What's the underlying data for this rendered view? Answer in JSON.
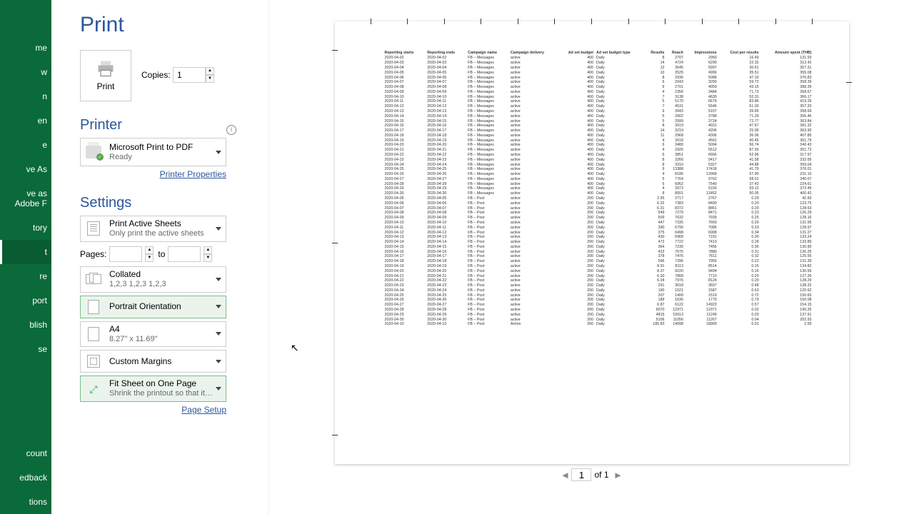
{
  "nav": {
    "items": [
      "me",
      "w",
      "n",
      "en",
      "e",
      "ve As",
      "ve as Adobe\nF",
      "tory",
      "t",
      "re",
      "port",
      "blish",
      "se"
    ],
    "bottom": [
      "count",
      "edback",
      "tions"
    ],
    "active_index": 8
  },
  "title": "Print",
  "print_button": "Print",
  "copies": {
    "label": "Copies:",
    "value": "1"
  },
  "printer": {
    "heading": "Printer",
    "name": "Microsoft Print to PDF",
    "status": "Ready",
    "properties_link": "Printer Properties"
  },
  "settings": {
    "heading": "Settings",
    "active_sheets": {
      "title": "Print Active Sheets",
      "sub": "Only print the active sheets"
    },
    "pages_label": "Pages:",
    "to_label": "to",
    "collated": {
      "title": "Collated",
      "sub": "1,2,3    1,2,3    1,2,3"
    },
    "orientation": "Portrait Orientation",
    "paper": {
      "title": "A4",
      "sub": "8.27\" x 11.69\""
    },
    "margins": "Custom Margins",
    "fit": {
      "title": "Fit Sheet on One Page",
      "sub": "Shrink the printout so that it…"
    },
    "page_setup_link": "Page Setup"
  },
  "pager": {
    "current": "1",
    "of": "of 1"
  },
  "preview": {
    "headers": [
      "Reporting starts",
      "Reporting ends",
      "Campaign name",
      "Campaign delivery",
      "Ad set budget",
      "Ad set budget type",
      "Results",
      "Reach",
      "Impressions",
      "Cost per results",
      "Amount spent (THB)"
    ],
    "rows": [
      [
        "2020-04-02",
        "2020-04-02",
        "FB – Messages",
        "active",
        "400",
        "Daily",
        "8",
        "2707",
        "2950",
        "16.49",
        "131.93"
      ],
      [
        "2020-04-03",
        "2020-04-03",
        "FB – Messages",
        "active",
        "400",
        "Daily",
        "14",
        "4724",
        "6290",
        "22.32",
        "312.42"
      ],
      [
        "2020-04-04",
        "2020-04-04",
        "FB – Messages",
        "active",
        "400",
        "Daily",
        "12",
        "3645",
        "5997",
        "30.61",
        "367.31"
      ],
      [
        "2020-04-05",
        "2020-04-05",
        "FB – Messages",
        "active",
        "400",
        "Daily",
        "10",
        "3525",
        "4996",
        "35.51",
        "355.08"
      ],
      [
        "2020-04-06",
        "2020-04-06",
        "FB – Messages",
        "active",
        "400",
        "Daily",
        "8",
        "2936",
        "5088",
        "47.10",
        "376.83"
      ],
      [
        "2020-04-07",
        "2020-04-07",
        "FB – Messages",
        "active",
        "400",
        "Daily",
        "6",
        "2043",
        "3200",
        "59.73",
        "358.39"
      ],
      [
        "2020-04-08",
        "2020-04-08",
        "FB – Messages",
        "active",
        "400",
        "Daily",
        "9",
        "2701",
        "4059",
        "43.15",
        "388.39"
      ],
      [
        "2020-04-09",
        "2020-04-09",
        "FB – Messages",
        "active",
        "400",
        "Daily",
        "4",
        "2356",
        "3484",
        "71.73",
        "358.67"
      ],
      [
        "2020-04-10",
        "2020-04-10",
        "FB – Messages",
        "active",
        "400",
        "Daily",
        "7",
        "3138",
        "4630",
        "52.31",
        "366.17"
      ],
      [
        "2020-04-11",
        "2020-04-11",
        "FB – Messages",
        "active",
        "400",
        "Daily",
        "5",
        "5170",
        "6679",
        "83.86",
        "419.29"
      ],
      [
        "2020-04-12",
        "2020-04-12",
        "FB – Messages",
        "active",
        "400",
        "Daily",
        "7",
        "4531",
        "5646",
        "51.03",
        "357.20"
      ],
      [
        "2020-04-13",
        "2020-04-13",
        "FB – Messages",
        "active",
        "400",
        "Daily",
        "9",
        "3943",
        "5157",
        "39.85",
        "358.69"
      ],
      [
        "2020-04-14",
        "2020-04-14",
        "FB – Messages",
        "active",
        "400",
        "Daily",
        "5",
        "2802",
        "3788",
        "71.29",
        "356.46"
      ],
      [
        "2020-04-15",
        "2020-04-15",
        "FB – Messages",
        "active",
        "400",
        "Daily",
        "5",
        "2999",
        "3724",
        "72.77",
        "363.84"
      ],
      [
        "2020-04-16",
        "2020-04-16",
        "FB – Messages",
        "active",
        "400",
        "Daily",
        "8",
        "3019",
        "4031",
        "47.67",
        "381.32"
      ],
      [
        "2020-04-17",
        "2020-04-17",
        "FB – Messages",
        "active",
        "400",
        "Daily",
        "14",
        "3219",
        "4206",
        "25.99",
        "363.90"
      ],
      [
        "2020-04-18",
        "2020-04-18",
        "FB – Messages",
        "active",
        "400",
        "Daily",
        "11",
        "2968",
        "4306",
        "36.06",
        "407.85"
      ],
      [
        "2020-04-19",
        "2020-04-19",
        "FB – Messages",
        "active",
        "400",
        "Daily",
        "4",
        "2618",
        "4562",
        "90.45",
        "361.79"
      ],
      [
        "2020-04-20",
        "2020-04-20",
        "FB – Messages",
        "active",
        "400",
        "Daily",
        "6",
        "3480",
        "5094",
        "56.74",
        "340.43"
      ],
      [
        "2020-04-21",
        "2020-04-21",
        "FB – Messages",
        "active",
        "400",
        "Daily",
        "4",
        "2926",
        "5512",
        "87.93",
        "351.72"
      ],
      [
        "2020-04-22",
        "2020-04-22",
        "FB – Messages",
        "active",
        "400",
        "Daily",
        "6",
        "3851",
        "6666",
        "52.96",
        "317.97"
      ],
      [
        "2020-04-23",
        "2020-04-23",
        "FB – Messages",
        "active",
        "400",
        "Daily",
        "8",
        "3266",
        "5417",
        "41.58",
        "332.65"
      ],
      [
        "2020-04-24",
        "2020-04-24",
        "FB – Messages",
        "active",
        "400",
        "Daily",
        "8",
        "3310",
        "5327",
        "44.88",
        "359.04"
      ],
      [
        "2020-04-25",
        "2020-04-25",
        "FB – Messages",
        "active",
        "400",
        "Daily",
        "9",
        "13388",
        "17418",
        "41.79",
        "376.01"
      ],
      [
        "2020-04-26",
        "2020-04-26",
        "FB – Messages",
        "active",
        "400",
        "Daily",
        "4",
        "8186",
        "12968",
        "57.90",
        "231.10"
      ],
      [
        "2020-04-27",
        "2020-04-27",
        "FB – Messages",
        "active",
        "400",
        "Daily",
        "5",
        "7764",
        "9762",
        "68.01",
        "340.07"
      ],
      [
        "2020-04-28",
        "2020-04-28",
        "FB – Messages",
        "active",
        "400",
        "Daily",
        "6",
        "6062",
        "7540",
        "37.43",
        "224.61"
      ],
      [
        "2020-04-29",
        "2020-04-29",
        "FB – Messages",
        "active",
        "400",
        "Daily",
        "4",
        "3973",
        "5150",
        "93.12",
        "372.49"
      ],
      [
        "2020-04-30",
        "2020-04-30",
        "FB – Messages",
        "active",
        "400",
        "Daily",
        "8",
        "8001",
        "12452",
        "50.05",
        "400.42"
      ],
      [
        "2020-04-05",
        "2020-04-05",
        "FB – Post",
        "active",
        "200",
        "Daily",
        "2.55",
        "2717",
        "2767",
        "0.29",
        "42.50"
      ],
      [
        "2020-04-06",
        "2020-04-06",
        "FB – Post",
        "active",
        "200",
        "Daily",
        "6.32",
        "7383",
        "8490",
        "0.20",
        "123.75"
      ],
      [
        "2020-04-07",
        "2020-04-07",
        "FB – Post",
        "active",
        "200",
        "Daily",
        "6.31",
        "8372",
        "8861",
        "0.20",
        "128.63"
      ],
      [
        "2020-04-08",
        "2020-04-08",
        "FB – Post",
        "active",
        "200",
        "Daily",
        "549",
        "7279",
        "8471",
        "0.23",
        "126.29"
      ],
      [
        "2020-04-09",
        "2020-04-09",
        "FB – Post",
        "active",
        "200",
        "Daily",
        "509",
        "7632",
        "7939",
        "0.25",
        "128.16"
      ],
      [
        "2020-04-10",
        "2020-04-10",
        "FB – Post",
        "active",
        "200",
        "Daily",
        "447",
        "7335",
        "7669",
        "0.29",
        "131.95"
      ],
      [
        "2020-04-11",
        "2020-04-11",
        "FB – Post",
        "active",
        "200",
        "Daily",
        "390",
        "6790",
        "7086",
        "0.33",
        "128.97"
      ],
      [
        "2020-04-12",
        "2020-04-12",
        "FB – Post",
        "active",
        "200",
        "Daily",
        "375",
        "6498",
        "6908",
        "0.34",
        "131.27"
      ],
      [
        "2020-04-13",
        "2020-04-13",
        "FB – Post",
        "active",
        "200",
        "Daily",
        "430",
        "6968",
        "7191",
        "0.30",
        "133.24"
      ],
      [
        "2020-04-14",
        "2020-04-14",
        "FB – Post",
        "active",
        "200",
        "Daily",
        "472",
        "7722",
        "7413",
        "0.28",
        "133.89"
      ],
      [
        "2020-04-15",
        "2020-04-15",
        "FB – Post",
        "active",
        "200",
        "Daily",
        "364",
        "7230",
        "7456",
        "0.36",
        "130.90"
      ],
      [
        "2020-04-16",
        "2020-04-16",
        "FB – Post",
        "active",
        "200",
        "Daily",
        "423",
        "7676",
        "7880",
        "0.31",
        "130.25"
      ],
      [
        "2020-04-17",
        "2020-04-17",
        "FB – Post",
        "active",
        "200",
        "Daily",
        "378",
        "7476",
        "7611",
        "0.32",
        "125.55"
      ],
      [
        "2020-04-18",
        "2020-04-18",
        "FB – Post",
        "active",
        "200",
        "Daily",
        "596",
        "7396",
        "7955",
        "0.22",
        "131.39"
      ],
      [
        "2020-04-19",
        "2020-04-19",
        "FB – Post",
        "active",
        "200",
        "Daily",
        "8.91",
        "8113",
        "8514",
        "0.15",
        "134.82"
      ],
      [
        "2020-04-20",
        "2020-04-20",
        "FB – Post",
        "active",
        "200",
        "Daily",
        "8.37",
        "9220",
        "9494",
        "0.16",
        "130.56"
      ],
      [
        "2020-04-21",
        "2020-04-21",
        "FB – Post",
        "active",
        "200",
        "Daily",
        "6.20",
        "7868",
        "7710",
        "0.20",
        "127.26"
      ],
      [
        "2020-04-22",
        "2020-04-22",
        "FB – Post",
        "active",
        "200",
        "Daily",
        "6.34",
        "7976",
        "8124",
        "0.20",
        "128.29"
      ],
      [
        "2020-04-23",
        "2020-04-23",
        "FB – Post",
        "active",
        "200",
        "Daily",
        "291",
        "3618",
        "3697",
        "0.48",
        "138.32"
      ],
      [
        "2020-04-24",
        "2020-04-24",
        "FB – Post",
        "active",
        "200",
        "Daily",
        "190",
        "1521",
        "1587",
        "0.63",
        "120.62"
      ],
      [
        "2020-04-25",
        "2020-04-25",
        "FB – Post",
        "active",
        "200",
        "Daily",
        "207",
        "1400",
        "1519",
        "0.72",
        "150.65"
      ],
      [
        "2020-04-26",
        "2020-04-26",
        "FB – Post",
        "active",
        "200",
        "Daily",
        "189",
        "1636",
        "1770",
        "0.79",
        "150.08"
      ],
      [
        "2020-04-27",
        "2020-04-27",
        "FB – Post",
        "active",
        "200",
        "Daily",
        "6.87",
        "6122",
        "14923",
        "0.57",
        "154.15"
      ],
      [
        "2020-04-28",
        "2020-04-28",
        "FB – Post",
        "active",
        "200",
        "Daily",
        "9070",
        "12971",
        "12371",
        "0.02",
        "190.26"
      ],
      [
        "2020-04-29",
        "2020-04-29",
        "FB – Post",
        "active",
        "200",
        "Daily",
        "4815",
        "10013",
        "11249",
        "0.03",
        "137.91"
      ],
      [
        "2020-04-30",
        "2020-04-30",
        "FB – Post",
        "active",
        "200",
        "Daily",
        "5106",
        "11056",
        "11267",
        "0.04",
        "202.93"
      ],
      [
        "2020-04-10",
        "2020-04-10",
        "FB – Post",
        "Active",
        "200",
        "Daily",
        "185.83",
        "14098",
        "18909",
        "0.01",
        "2.59"
      ]
    ]
  }
}
